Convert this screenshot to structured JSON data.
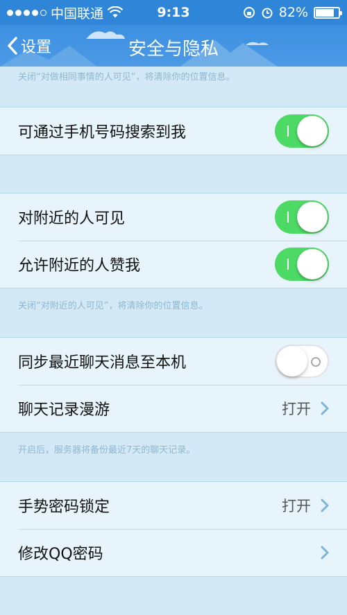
{
  "status_bar": {
    "carrier": "中国联通",
    "time": "9:13",
    "battery": "82%",
    "battery_level": 0.82,
    "signal_bars_filled": 4,
    "signal_bars_total": 5
  },
  "nav": {
    "back_label": "设置",
    "title": "安全与隐私"
  },
  "notes": {
    "top": "关闭“对做相同事情的人可见”，将清除你的位置信息。",
    "nearby": "关闭“对附近的人可见”，将清除你的位置信息。",
    "chat": "开启后，服务器将备份最近7天的聊天记录。"
  },
  "rows": {
    "phone_search": {
      "label": "可通过手机号码搜索到我",
      "on": true
    },
    "nearby_visible": {
      "label": "对附近的人可见",
      "on": true
    },
    "nearby_like": {
      "label": "允许附近的人赞我",
      "on": true
    },
    "sync_chat": {
      "label": "同步最近聊天消息至本机",
      "on": false
    },
    "chat_roaming": {
      "label": "聊天记录漫游",
      "value": "打开"
    },
    "gesture_lock": {
      "label": "手势密码锁定",
      "value": "打开"
    },
    "change_password": {
      "label": "修改QQ密码"
    }
  },
  "colors": {
    "nav": "#3c8fe0",
    "toggle_on": "#4cd964",
    "background": "#d3e9f5",
    "section": "#e7f4fb",
    "chevron": "#7ab3dc"
  }
}
